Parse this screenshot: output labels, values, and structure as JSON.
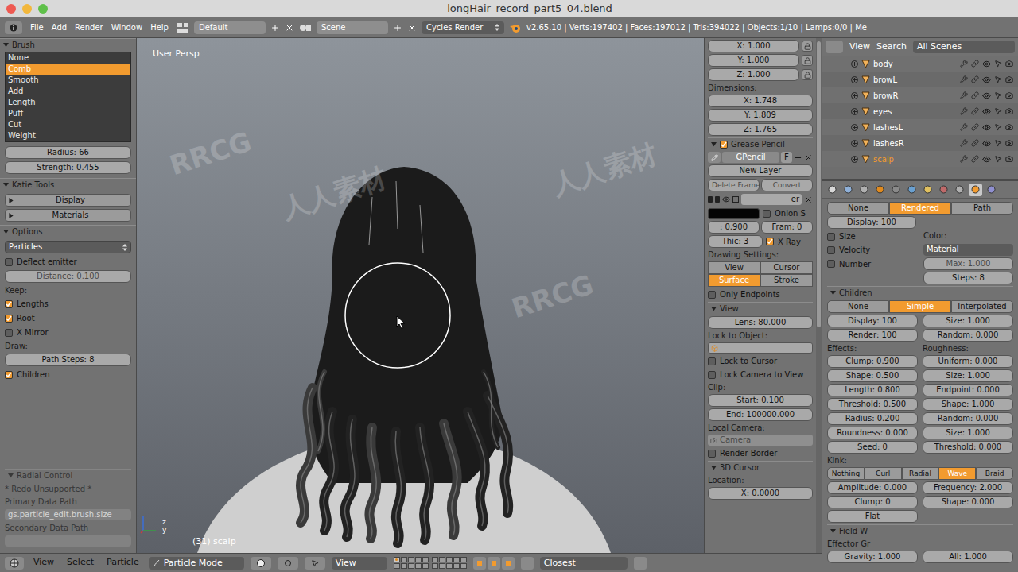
{
  "window": {
    "title": "longHair_record_part5_04.blend"
  },
  "info_header": {
    "menus": [
      "File",
      "Add",
      "Render",
      "Window",
      "Help"
    ],
    "layout": "Default",
    "scene": "Scene",
    "engine": "Cycles Render",
    "stats": "v2.65.10 | Verts:197402 | Faces:197012 | Tris:394022 | Objects:1/10 | Lamps:0/0 | Me"
  },
  "tool_shelf": {
    "brush": {
      "title": "Brush",
      "items": [
        {
          "label": "None",
          "selected": false
        },
        {
          "label": "Comb",
          "selected": true
        },
        {
          "label": "Smooth",
          "selected": false
        },
        {
          "label": "Add",
          "selected": false
        },
        {
          "label": "Length",
          "selected": false
        },
        {
          "label": "Puff",
          "selected": false
        },
        {
          "label": "Cut",
          "selected": false
        },
        {
          "label": "Weight",
          "selected": false
        }
      ],
      "radius": "Radius: 66",
      "strength": "Strength: 0.455"
    },
    "katie_tools": {
      "title": "Katie Tools",
      "buttons": [
        "Display",
        "Materials"
      ]
    },
    "options": {
      "title": "Options",
      "mode": "Particles",
      "deflect": {
        "label": "Deflect emitter",
        "checked": false
      },
      "distance": "Distance: 0.100",
      "keep_label": "Keep:",
      "keep": [
        {
          "label": "Lengths",
          "checked": true
        },
        {
          "label": "Root",
          "checked": true
        },
        {
          "label": "X Mirror",
          "checked": false
        }
      ],
      "draw_label": "Draw:",
      "path_steps": "Path Steps: 8",
      "children": {
        "label": "Children",
        "checked": true
      }
    },
    "operator": {
      "title": "Radial Control",
      "redo": "* Redo Unsupported *",
      "primary_label": "Primary Data Path",
      "primary_value": "gs.particle_edit.brush.size",
      "secondary_label": "Secondary Data Path"
    }
  },
  "viewport": {
    "view": "User Persp",
    "object": "(31) scalp",
    "axes": [
      "z",
      "y"
    ],
    "watermarks": [
      "RRCG",
      "人人素材",
      "RRCG",
      "人人素材"
    ]
  },
  "n_panel": {
    "scale": [
      "X: 1.000",
      "Y: 1.000",
      "Z: 1.000"
    ],
    "dimensions_label": "Dimensions:",
    "dimensions": [
      "X: 1.748",
      "Y: 1.809",
      "Z: 1.765"
    ],
    "grease_pencil": {
      "title": "Grease Pencil",
      "enabled": true,
      "datablock": "GPencil",
      "fake": "F",
      "new_layer": "New Layer",
      "delete_frame": "Delete Frame",
      "convert": "Convert",
      "layer_name": "er",
      "onion": {
        "label": "Onion S",
        "checked": false
      },
      "opacity": ": 0.900",
      "frame": "Fram: 0",
      "thickness": "Thic: 3",
      "xray": {
        "label": "X Ray",
        "checked": true
      },
      "drawing_label": "Drawing Settings:",
      "drawing_modes": [
        {
          "label": "View",
          "selected": false
        },
        {
          "label": "Cursor",
          "selected": false
        },
        {
          "label": "Surface",
          "selected": true
        },
        {
          "label": "Stroke",
          "selected": false
        }
      ],
      "only_endpoints": {
        "label": "Only Endpoints",
        "checked": false
      }
    },
    "view": {
      "title": "View",
      "lens": "Lens: 80.000",
      "lock_object_label": "Lock to Object:",
      "lock_cursor": {
        "label": "Lock to Cursor",
        "checked": false
      },
      "lock_camera": {
        "label": "Lock Camera to View",
        "checked": false
      },
      "clip_label": "Clip:",
      "clip_start": "Start: 0.100",
      "clip_end": "End: 100000.000",
      "local_camera_label": "Local Camera:",
      "local_camera": "Camera",
      "render_border": {
        "label": "Render Border",
        "checked": false
      }
    },
    "cursor": {
      "title": "3D Cursor",
      "location_label": "Location:",
      "x": "X: 0.0000"
    }
  },
  "outliner": {
    "menus": [
      "View",
      "Search"
    ],
    "filter": "All Scenes",
    "items": [
      {
        "name": "body",
        "selected": false
      },
      {
        "name": "browL",
        "selected": false
      },
      {
        "name": "browR",
        "selected": false
      },
      {
        "name": "eyes",
        "selected": false
      },
      {
        "name": "lashesL",
        "selected": false
      },
      {
        "name": "lashesR",
        "selected": false
      },
      {
        "name": "scalp",
        "selected": true
      }
    ]
  },
  "properties": {
    "tabs": [
      {
        "selected": false
      },
      {
        "selected": false
      },
      {
        "selected": false
      },
      {
        "selected": false
      },
      {
        "selected": false
      },
      {
        "selected": false
      },
      {
        "selected": false
      },
      {
        "selected": false
      },
      {
        "selected": false
      },
      {
        "selected": true
      },
      {
        "selected": false
      }
    ],
    "display": {
      "modes": [
        {
          "label": "None",
          "selected": false
        },
        {
          "label": "Rendered",
          "selected": true
        },
        {
          "label": "Path",
          "selected": false
        }
      ],
      "amount": "Display: 100",
      "checks": [
        {
          "label": "Size",
          "checked": false
        },
        {
          "label": "Velocity",
          "checked": false
        },
        {
          "label": "Number",
          "checked": false
        }
      ],
      "color_label": "Color:",
      "color": "Material",
      "max": "Max: 1.000",
      "steps": "Steps: 8"
    },
    "children": {
      "title": "Children",
      "modes": [
        {
          "label": "None",
          "selected": false
        },
        {
          "label": "Simple",
          "selected": true
        },
        {
          "label": "Interpolated",
          "selected": false
        }
      ],
      "display": "Display: 100",
      "render": "Render: 100",
      "size": "Size: 1.000",
      "random": "Random: 0.000",
      "effects_label": "Effects:",
      "roughness_label": "Roughness:",
      "effects": [
        "Clump: 0.900",
        "Shape: 0.500",
        "Length: 0.800",
        "Threshold: 0.500",
        "Radius: 0.200",
        "Roundness: 0.000",
        "Seed: 0"
      ],
      "roughness": [
        "Uniform: 0.000",
        "Size: 1.000",
        "Endpoint: 0.000",
        "Shape: 1.000",
        "Random: 0.000",
        "Size: 1.000",
        "Threshold: 0.000"
      ],
      "kink_label": "Kink:",
      "kinks": [
        {
          "label": "Nothing",
          "selected": false
        },
        {
          "label": "Curl",
          "selected": false
        },
        {
          "label": "Radial",
          "selected": false
        },
        {
          "label": "Wave",
          "selected": true
        },
        {
          "label": "Braid",
          "selected": false
        }
      ],
      "kink_left": [
        "Amplitude: 0.000",
        "Clump: 0",
        "Flat"
      ],
      "kink_right": [
        "Frequency: 2.000",
        "Shape: 0.000"
      ]
    },
    "field_weights": {
      "title": "Field W",
      "effector_group": "Effector Gr",
      "gravity": "Gravity: 1.000",
      "all": "All: 1.000"
    }
  },
  "bottom_header": {
    "menus": [
      "View",
      "Select",
      "Particle"
    ],
    "mode": "Particle Mode",
    "orientation": "View",
    "select": "Closest",
    "layers": [
      {
        "active": true
      },
      {
        "active": false
      },
      {
        "active": false
      },
      {
        "active": false
      },
      {
        "active": false
      },
      {
        "active": false
      },
      {
        "active": false
      },
      {
        "active": false
      },
      {
        "active": false
      },
      {
        "active": false
      },
      {
        "active": false
      },
      {
        "active": false
      },
      {
        "active": false
      },
      {
        "active": false
      },
      {
        "active": false
      },
      {
        "active": false
      },
      {
        "active": false
      },
      {
        "active": false
      },
      {
        "active": false
      },
      {
        "active": false
      }
    ]
  }
}
